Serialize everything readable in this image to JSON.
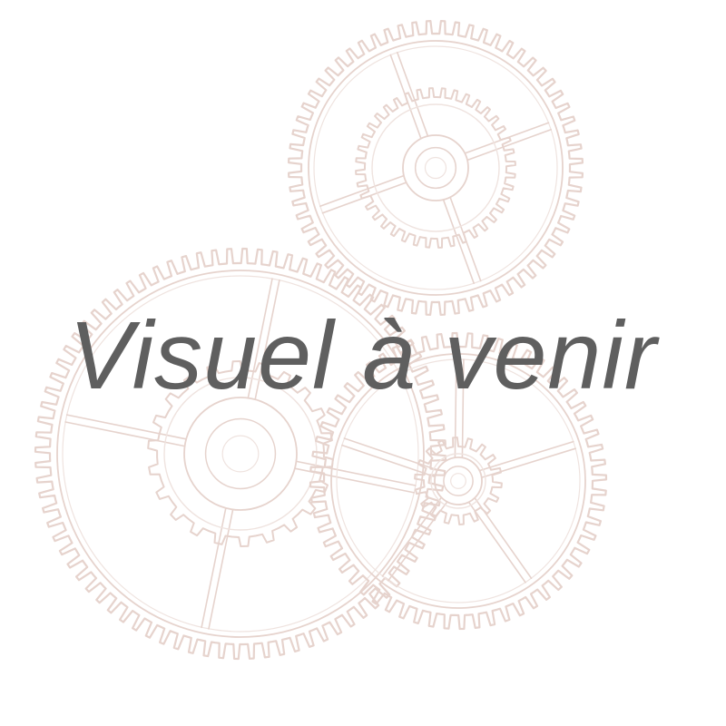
{
  "placeholder": {
    "caption": "Visuel à venir",
    "caption_color": "#5f5f5f",
    "background_color": "#ffffff",
    "illustration": "gears-sketch-icon",
    "illustration_color": "#e6d3cd",
    "illustration_light_color": "#efe3df"
  }
}
